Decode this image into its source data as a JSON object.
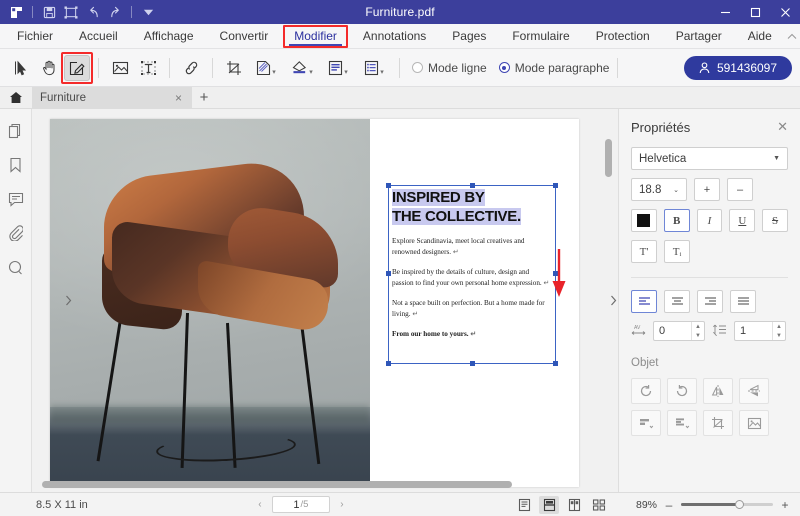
{
  "window": {
    "title": "Furniture.pdf",
    "quick_access": [
      "app-logo",
      "save-icon",
      "object-select-icon",
      "undo-icon",
      "redo-icon",
      "customize-dropdown-icon"
    ],
    "controls": {
      "minimize": "—",
      "maximize": "□",
      "close": "✕"
    }
  },
  "menu": {
    "tabs": [
      {
        "label": "Fichier",
        "active": false
      },
      {
        "label": "Accueil",
        "active": false
      },
      {
        "label": "Affichage",
        "active": false
      },
      {
        "label": "Convertir",
        "active": false
      },
      {
        "label": "Modifier",
        "active": true,
        "highlighted": true
      },
      {
        "label": "Annotations",
        "active": false
      },
      {
        "label": "Pages",
        "active": false
      },
      {
        "label": "Formulaire",
        "active": false
      },
      {
        "label": "Protection",
        "active": false
      },
      {
        "label": "Partager",
        "active": false
      },
      {
        "label": "Aide",
        "active": false
      }
    ],
    "collapse_icon": "chevron-up-icon"
  },
  "toolbar": {
    "tools": [
      {
        "name": "select-tool",
        "selected": false
      },
      {
        "name": "hand-tool",
        "selected": false
      },
      {
        "name": "edit-tool",
        "selected": true,
        "highlighted": true
      },
      {
        "name": "add-image-tool",
        "selected": false
      },
      {
        "name": "add-text-tool",
        "selected": false
      },
      {
        "name": "link-tool",
        "selected": false
      },
      {
        "name": "crop-tool",
        "selected": false
      },
      {
        "name": "watermark-tool",
        "selected": false
      },
      {
        "name": "background-tool",
        "selected": false
      },
      {
        "name": "header-footer-tool",
        "selected": false
      },
      {
        "name": "bates-numbering-tool",
        "selected": false
      }
    ],
    "mode_line_label": "Mode ligne",
    "mode_paragraph_label": "Mode paragraphe",
    "mode_selected": "Mode paragraphe",
    "account_id": "591436097",
    "account_icon": "user-icon"
  },
  "doc_tabs": {
    "home_icon": "home-icon",
    "tabs": [
      {
        "label": "Furniture",
        "close": "×",
        "active": true
      }
    ],
    "new_tab": "+"
  },
  "left_rail": {
    "items": [
      {
        "name": "thumbnails-icon"
      },
      {
        "name": "bookmarks-icon"
      },
      {
        "name": "comments-icon"
      },
      {
        "name": "attachments-icon"
      },
      {
        "name": "search-icon"
      }
    ]
  },
  "document": {
    "heading_line1": "INSPIRED BY",
    "heading_line2": "THE COLLECTIVE.",
    "paragraphs": [
      {
        "text": "Explore Scandinavia, meet local creatives and renowned designers.",
        "bold": false
      },
      {
        "text": "Be inspired by the details of culture, design and passion to find your own personal home expression.",
        "bold": false
      },
      {
        "text": "Not a space built on perfection. But a home made for living.",
        "bold": false
      },
      {
        "text": "From our home to yours.",
        "bold": true
      }
    ],
    "pilcrow": "↵",
    "image_alt": "brown-leather-bar-stool-photo",
    "annotation_arrow": "red-down-arrow"
  },
  "properties": {
    "title": "Propriétés",
    "close": "✕",
    "font_family": "Helvetica",
    "font_size": "18.8",
    "increase_label": "+",
    "decrease_label": "–",
    "color_swatch": "#111111",
    "style_buttons": [
      {
        "name": "bold-button",
        "label": "B",
        "active": true
      },
      {
        "name": "italic-button",
        "label": "I",
        "active": false
      },
      {
        "name": "underline-button",
        "label": "U",
        "active": false
      },
      {
        "name": "strikethrough-button",
        "label": "S",
        "active": false
      }
    ],
    "script_buttons": [
      {
        "name": "superscript-button",
        "label": "T'",
        "active": false
      },
      {
        "name": "subscript-button",
        "label": "Tᵢ",
        "active": false
      }
    ],
    "align_buttons": [
      {
        "name": "align-left-button",
        "active": true
      },
      {
        "name": "align-center-button",
        "active": false
      },
      {
        "name": "align-right-button",
        "active": false
      },
      {
        "name": "align-justify-button",
        "active": false
      }
    ],
    "letter_spacing_label": "letter-spacing-icon",
    "letter_spacing": "0",
    "line_height_label": "line-height-icon",
    "line_height": "1",
    "object_section_title": "Objet",
    "object_buttons": [
      {
        "name": "rotate-left-button"
      },
      {
        "name": "rotate-right-button"
      },
      {
        "name": "flip-horizontal-button"
      },
      {
        "name": "flip-vertical-button"
      },
      {
        "name": "align-objects-button"
      },
      {
        "name": "distribute-objects-button"
      },
      {
        "name": "crop-image-button"
      },
      {
        "name": "replace-image-button"
      }
    ]
  },
  "status": {
    "page_size": "8.5 X 11 in",
    "page_current": "1",
    "page_total": "/5",
    "prev": "‹",
    "next": "›",
    "view_modes": [
      {
        "name": "single-page-view",
        "active": false
      },
      {
        "name": "continuous-view",
        "active": true
      },
      {
        "name": "facing-pages-view",
        "active": false
      },
      {
        "name": "grid-view",
        "active": false
      }
    ],
    "zoom_level": "89%",
    "zoom_out": "–",
    "zoom_in": "+"
  },
  "colors": {
    "titlebar": "#3c3f9c",
    "accent": "#2f3a9e",
    "highlight_box": "#f42a2a",
    "selection": "#c8c9ef",
    "selection_frame": "#3b63c4"
  }
}
